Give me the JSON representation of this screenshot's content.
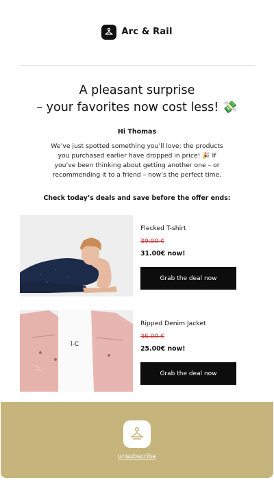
{
  "brand": {
    "name": "Arc & Rail",
    "logo_icon": "hanger-icon"
  },
  "headline": {
    "line1": "A pleasant surprise",
    "line2": "– your favorites now cost less! 💸"
  },
  "greeting": "Hi Thomas",
  "intro": "We’ve just spotted something you’ll love: the products you purchased earlier have dropped in price! 🎉 If you’ve been thinking about getting another one – or recommending it to a friend – now’s the perfect time.",
  "cta_line": "Check today’s deals and save before the offer ends:",
  "products": [
    {
      "name": "Flecked T-shirt",
      "old_price": "39.00 €",
      "new_price": "31.00€ now!",
      "button": "Grab the deal now"
    },
    {
      "name": "Ripped Denim Jacket",
      "old_price": "36.00 €",
      "new_price": "25.00€ now!",
      "button": "Grab the deal now"
    }
  ],
  "footer": {
    "unsubscribe": "unsubscribe",
    "bg_color": "#c5b57c"
  }
}
